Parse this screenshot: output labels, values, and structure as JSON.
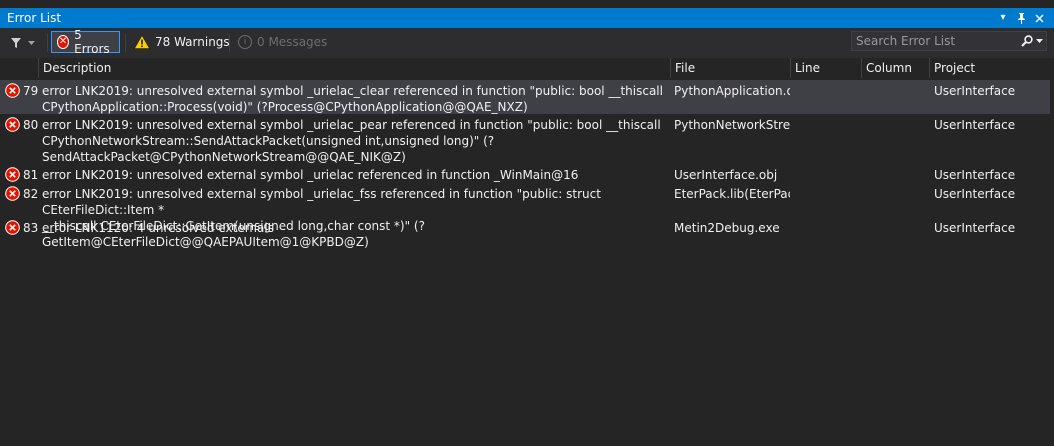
{
  "window": {
    "title": "Error List",
    "menu_icon": "dropdown-arrow-icon",
    "pin_icon": "pin-icon",
    "close_icon": "close-icon"
  },
  "toolbar": {
    "filter_icon": "filter-icon",
    "errors_label": "5 Errors",
    "warnings_label": "78 Warnings",
    "messages_label": "0 Messages",
    "search_placeholder": "Search Error List",
    "search_icon": "search-icon"
  },
  "columns": {
    "description": "Description",
    "file": "File",
    "line": "Line",
    "column": "Column",
    "project": "Project"
  },
  "rows": [
    {
      "num": "79",
      "description": "error LNK2019: unresolved external symbol _urielac_clear referenced in function \"public: bool __thiscall\nCPythonApplication::Process(void)\" (?Process@CPythonApplication@@QAE_NXZ)",
      "file": "PythonApplication.obj",
      "line": "",
      "column": "",
      "project": "UserInterface"
    },
    {
      "num": "80",
      "description": "error LNK2019: unresolved external symbol _urielac_pear referenced in function \"public: bool __thiscall\nCPythonNetworkStream::SendAttackPacket(unsigned int,unsigned long)\" (?\nSendAttackPacket@CPythonNetworkStream@@QAE_NIK@Z)",
      "file": "PythonNetworkStream",
      "line": "",
      "column": "",
      "project": "UserInterface"
    },
    {
      "num": "81",
      "description": "error LNK2019: unresolved external symbol _urielac referenced in function _WinMain@16",
      "file": "UserInterface.obj",
      "line": "",
      "column": "",
      "project": "UserInterface"
    },
    {
      "num": "82",
      "description": "error LNK2019: unresolved external symbol _urielac_fss referenced in function \"public: struct CEterFileDict::Item *\n__thiscall CEterFileDict::GetItem(unsigned long,char const *)\" (?GetItem@CEterFileDict@@QAEPAUItem@1@KPBD@Z)",
      "file": "EterPack.lib(EterPack.c",
      "line": "",
      "column": "",
      "project": "UserInterface"
    },
    {
      "num": "83",
      "description": "error LNK1120: 4 unresolved externals",
      "file": "Metin2Debug.exe",
      "line": "",
      "column": "",
      "project": "UserInterface"
    }
  ],
  "colors": {
    "accent": "#007acc",
    "error": "#e51400",
    "warning": "#ffcc00",
    "background": "#252526"
  }
}
